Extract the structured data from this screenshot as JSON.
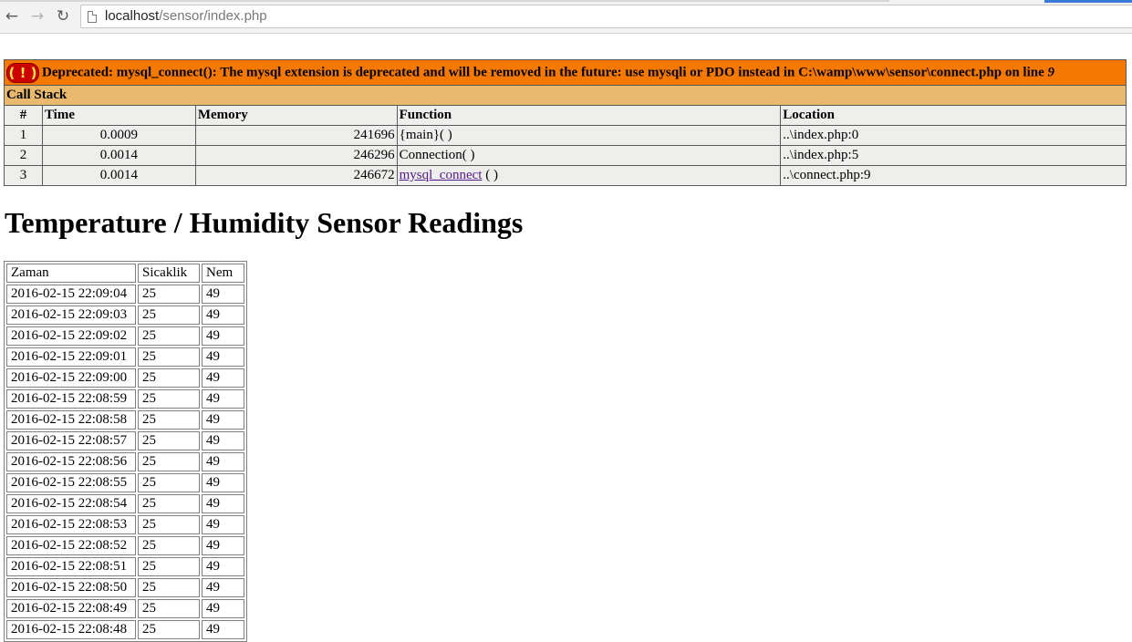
{
  "browser": {
    "url_host": "localhost",
    "url_path": "/sensor/index.php",
    "back_icon": "back-arrow-icon",
    "forward_icon": "forward-arrow-icon",
    "reload_icon": "reload-icon",
    "page_icon": "page-icon"
  },
  "error": {
    "icon_text": "( ! )",
    "message": "Deprecated: mysql_connect(): The mysql extension is deprecated and will be removed in the future: use mysqli or PDO instead in C:\\wamp\\www\\sensor\\connect.php on line ",
    "line": "9",
    "call_stack_label": "Call Stack",
    "headers": {
      "num": "#",
      "time": "Time",
      "memory": "Memory",
      "function": "Function",
      "location": "Location"
    },
    "rows": [
      {
        "num": "1",
        "time": "0.0009",
        "memory": "241696",
        "function": "{main}( )",
        "location": "..\\index.php:0"
      },
      {
        "num": "2",
        "time": "0.0014",
        "memory": "246296",
        "function": "Connection( )",
        "location": "..\\index.php:5"
      },
      {
        "num": "3",
        "time": "0.0014",
        "memory": "246672",
        "function_link": "mysql_connect",
        "function_suffix": " ( )",
        "location": "..\\connect.php:9"
      }
    ],
    "colors": {
      "error_bg": "#f57900",
      "callstack_bg": "#e9b96e",
      "cell_bg": "#eeeeec",
      "icon_bg": "#cc0000",
      "icon_fg": "#fce94f"
    }
  },
  "page_title": "Temperature / Humidity Sensor Readings",
  "readings": {
    "headers": [
      "Zaman",
      "Sicaklik",
      "Nem"
    ],
    "rows": [
      [
        "2016-02-15 22:09:04",
        "25",
        "49"
      ],
      [
        "2016-02-15 22:09:03",
        "25",
        "49"
      ],
      [
        "2016-02-15 22:09:02",
        "25",
        "49"
      ],
      [
        "2016-02-15 22:09:01",
        "25",
        "49"
      ],
      [
        "2016-02-15 22:09:00",
        "25",
        "49"
      ],
      [
        "2016-02-15 22:08:59",
        "25",
        "49"
      ],
      [
        "2016-02-15 22:08:58",
        "25",
        "49"
      ],
      [
        "2016-02-15 22:08:57",
        "25",
        "49"
      ],
      [
        "2016-02-15 22:08:56",
        "25",
        "49"
      ],
      [
        "2016-02-15 22:08:55",
        "25",
        "49"
      ],
      [
        "2016-02-15 22:08:54",
        "25",
        "49"
      ],
      [
        "2016-02-15 22:08:53",
        "25",
        "49"
      ],
      [
        "2016-02-15 22:08:52",
        "25",
        "49"
      ],
      [
        "2016-02-15 22:08:51",
        "25",
        "49"
      ],
      [
        "2016-02-15 22:08:50",
        "25",
        "49"
      ],
      [
        "2016-02-15 22:08:49",
        "25",
        "49"
      ],
      [
        "2016-02-15 22:08:48",
        "25",
        "49"
      ]
    ]
  }
}
